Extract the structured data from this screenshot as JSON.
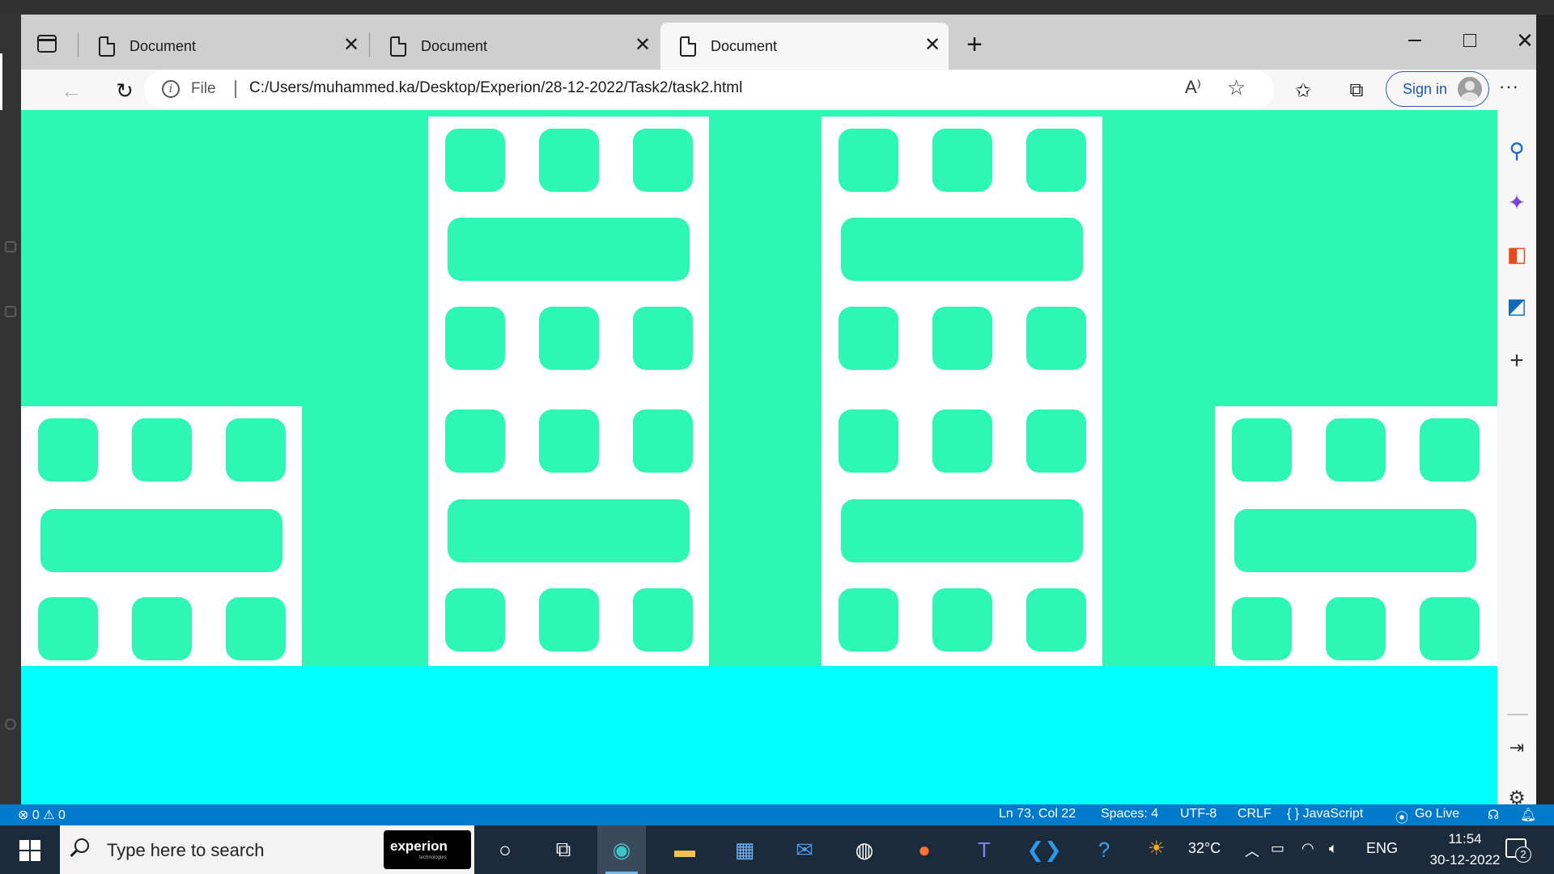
{
  "browser": {
    "tabs": [
      {
        "title": "Document"
      },
      {
        "title": "Document"
      },
      {
        "title": "Document"
      }
    ],
    "address": {
      "scheme_label": "File",
      "url": "C:/Users/muhammed.ka/Desktop/Experion/28-12-2022/Task2/task2.html"
    },
    "signin_label": "Sign in",
    "more_label": "···"
  },
  "page": {
    "background_color": "#2df7b3",
    "ground_color": "#00ffff",
    "building_color": "#ffffff"
  },
  "statusbar": {
    "problems": "⊗ 0 ⚠ 0",
    "position": "Ln 73, Col 22",
    "spaces": "Spaces: 4",
    "encoding": "UTF-8",
    "eol": "CRLF",
    "language": "{ }  JavaScript",
    "golive": "Go Live"
  },
  "taskbar": {
    "search_placeholder": "Type here to search",
    "search_brand": "experion",
    "search_brand_sub": "technologies",
    "temperature": "32°C",
    "language": "ENG",
    "time": "11:54",
    "date": "30-12-2022",
    "notification_count": "2"
  }
}
